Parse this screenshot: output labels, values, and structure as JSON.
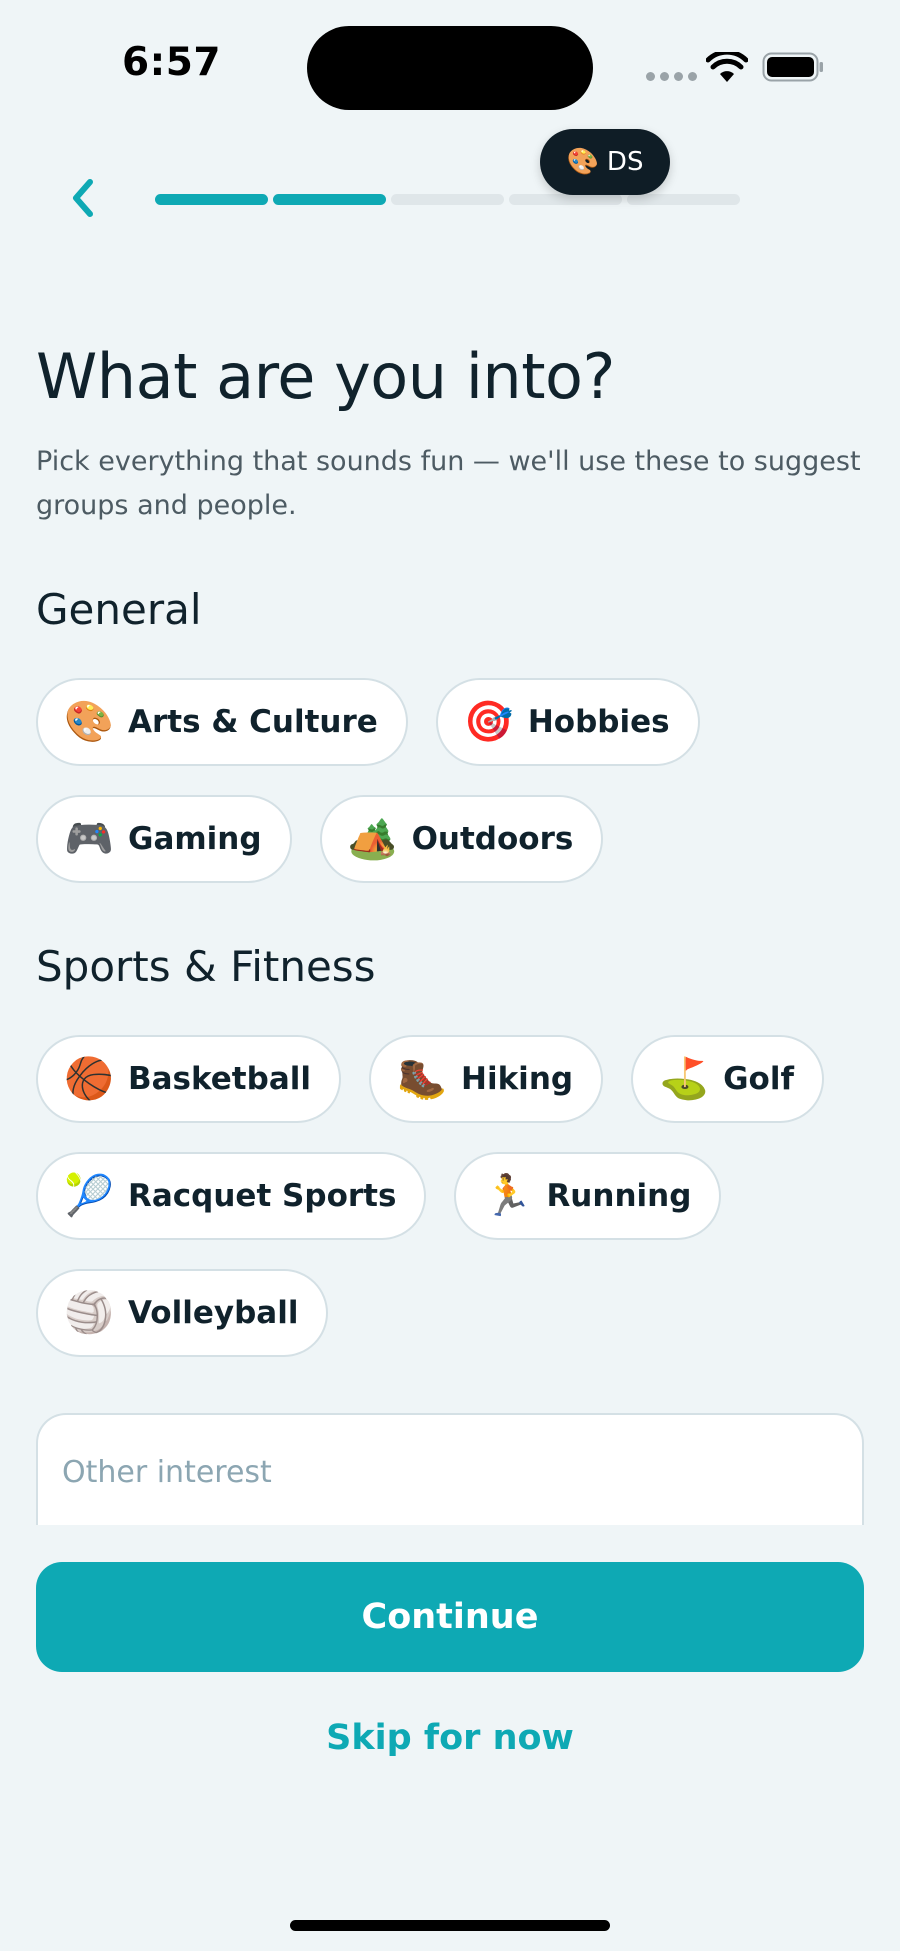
{
  "status_bar": {
    "time": "6:57"
  },
  "header": {
    "progress": {
      "completed_steps": 2,
      "total_steps": 5
    },
    "user_badge": {
      "emoji": "🎨",
      "initials": "DS"
    }
  },
  "main": {
    "title": "What are you into?",
    "subtitle": "Pick everything that sounds fun — we'll use these to suggest groups and people."
  },
  "sections": [
    {
      "title": "General",
      "chips": [
        {
          "emoji": "🎨",
          "label": "Arts & Culture"
        },
        {
          "emoji": "🎯",
          "label": "Hobbies"
        },
        {
          "emoji": "🎮",
          "label": "Gaming"
        },
        {
          "emoji": "🏕️",
          "label": "Outdoors"
        }
      ]
    },
    {
      "title": "Sports & Fitness",
      "chips": [
        {
          "emoji": "🏀",
          "label": "Basketball"
        },
        {
          "emoji": "🥾",
          "label": "Hiking"
        },
        {
          "emoji": "⛳",
          "label": "Golf"
        },
        {
          "emoji": "🎾",
          "label": "Racquet Sports"
        },
        {
          "emoji": "🏃",
          "label": "Running"
        },
        {
          "emoji": "🏐",
          "label": "Volleyball"
        }
      ]
    }
  ],
  "other_interest": {
    "value": "",
    "placeholder": "Other interest"
  },
  "actions": {
    "continue_label": "Continue",
    "skip_label": "Skip for now"
  },
  "colors": {
    "accent": "#0ea9b4",
    "background": "#eff5f7",
    "text": "#10222c",
    "chip_border": "#d4e0e5"
  }
}
